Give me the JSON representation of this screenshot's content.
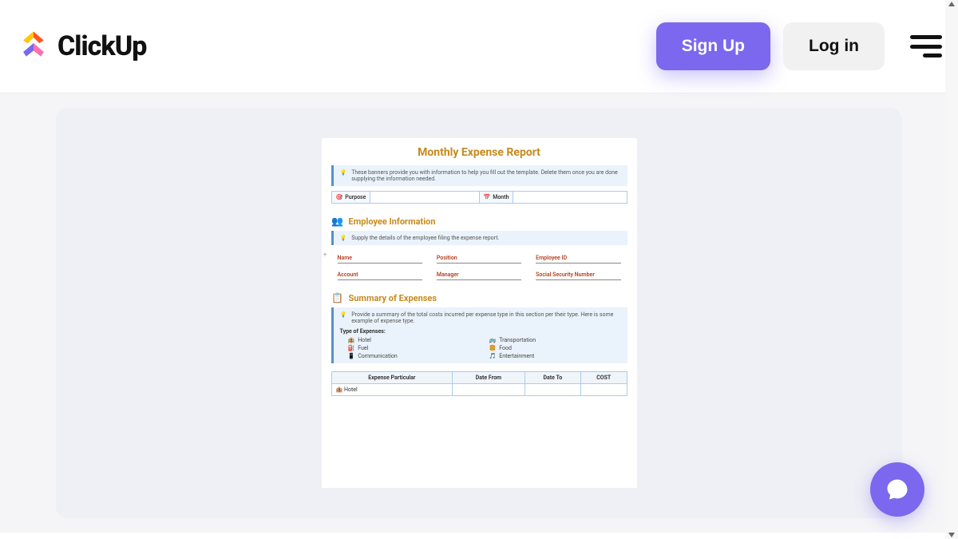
{
  "header": {
    "brand": "ClickUp",
    "signup_label": "Sign Up",
    "login_label": "Log in"
  },
  "document": {
    "title": "Monthly Expense Report",
    "banner1": "These banners provide you with information to help you fill out the template. Delete them once you are done supplying the information needed.",
    "meta": {
      "purpose_label": "Purpose",
      "month_label": "Month"
    },
    "employee": {
      "section_title": "Employee Information",
      "banner": "Supply the details of the employee filing the expense report.",
      "fields": {
        "name": "Name",
        "position": "Position",
        "employee_id": "Employee ID",
        "account": "Account",
        "manager": "Manager",
        "ssn": "Social Security Number"
      }
    },
    "summary": {
      "section_title": "Summary of Expenses",
      "banner": "Provide a summary of the total costs incurred per expense type in this section per their type. Here is some example of expense type.",
      "types_label": "Type of Expenses:",
      "types": {
        "hotel": "Hotel",
        "transportation": "Transportation",
        "fuel": "Fuel",
        "food": "Food",
        "communication": "Communication",
        "entertainment": "Entertainment"
      }
    },
    "table": {
      "headers": {
        "particular": "Expense Particular",
        "date_from": "Date From",
        "date_to": "Date To",
        "cost": "COST"
      },
      "rows": [
        {
          "particular": "Hotel"
        }
      ]
    }
  }
}
